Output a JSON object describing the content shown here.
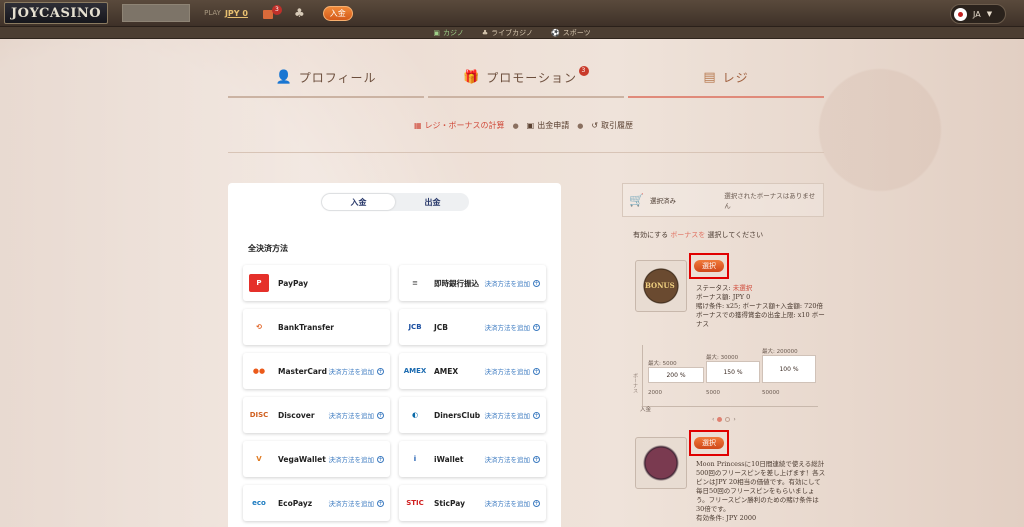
{
  "topbar": {
    "logo": "JOYCASINO",
    "balance_label": "PLAY",
    "balance": "JPY 0",
    "gift_badge": "3",
    "deposit_label": "入金",
    "lang": "JA"
  },
  "subnav": {
    "items": [
      {
        "label": "カジノ",
        "icon": "casino-icon"
      },
      {
        "label": "ライブカジノ",
        "icon": "live-casino-icon"
      },
      {
        "label": "スポーツ",
        "icon": "sports-icon"
      }
    ]
  },
  "tabs": {
    "profile": "プロフィール",
    "promotion": "プロモーション",
    "promotion_badge": "3",
    "cashier": "レジ"
  },
  "cashier_nav": {
    "bonus_calc": "レジ・ボーナスの計算",
    "withdraw_request": "出金申請",
    "history": "取引履歴"
  },
  "panel": {
    "toggle": {
      "deposit": "入金",
      "withdraw": "出金"
    },
    "all_methods": "全決済方法",
    "add_label": "決済方法を追加",
    "methods": [
      {
        "name": "PayPay",
        "logo": "P",
        "color": "#e5302a"
      },
      {
        "name": "即時銀行振込",
        "logo": "≡",
        "color": "#666666"
      },
      {
        "name": "BankTransfer",
        "logo": "⟲",
        "color": "#e06020"
      },
      {
        "name": "JCB",
        "logo": "JCB",
        "color": "#1a4ea0"
      },
      {
        "name": "MasterCard",
        "logo": "●●",
        "color": "#eb5a1a"
      },
      {
        "name": "AMEX",
        "logo": "AMEX",
        "color": "#1a6ab0"
      },
      {
        "name": "Discover",
        "logo": "DISC",
        "color": "#d06020"
      },
      {
        "name": "DinersClub",
        "logo": "◐",
        "color": "#0a6aa8"
      },
      {
        "name": "VegaWallet",
        "logo": "V",
        "color": "#e07a20"
      },
      {
        "name": "iWallet",
        "logo": "i",
        "color": "#1a5ab0"
      },
      {
        "name": "EcoPayz",
        "logo": "eco",
        "color": "#1a7ac0"
      },
      {
        "name": "SticPay",
        "logo": "STIC",
        "color": "#d02020"
      }
    ]
  },
  "bonus_side": {
    "selected_label": "選択済み",
    "selected_value": "選択されたボーナスはありません",
    "choose_prefix": "有効にする",
    "choose_highlight": "ボーナスを",
    "choose_suffix": "選択してください",
    "select_button": "選択",
    "bonus1": {
      "image_text": "BONUS",
      "status_label": "ステータス:",
      "status_value": "未選択",
      "amount": "ボーナス額: JPY 0",
      "wager": "賭け条件: x25; ボーナス額+入金額: 720倍",
      "max": "ボーナスでの獲得賞金の出金上限: x10 ボーナス"
    },
    "chart": {
      "y_label": "ボーナス",
      "x_label": "入金",
      "steps": [
        {
          "max": "最大: 5000",
          "pct": "200 %",
          "from": "2000"
        },
        {
          "max": "最大: 30000",
          "pct": "150 %",
          "from": "5000"
        },
        {
          "max": "最大: 200000",
          "pct": "100 %",
          "from": "50000"
        }
      ]
    },
    "bonus2": {
      "text": "Moon Princessに10日間連続で使える総計500回のフリースピンを差し上げます！各スピンはJPY 20相当の価値です。有効にして毎日50回のフリースピンをもらいましょう。フリースピン勝利のための賭け条件は30倍です。",
      "min_deposit": "有効条件: JPY 2000"
    }
  }
}
